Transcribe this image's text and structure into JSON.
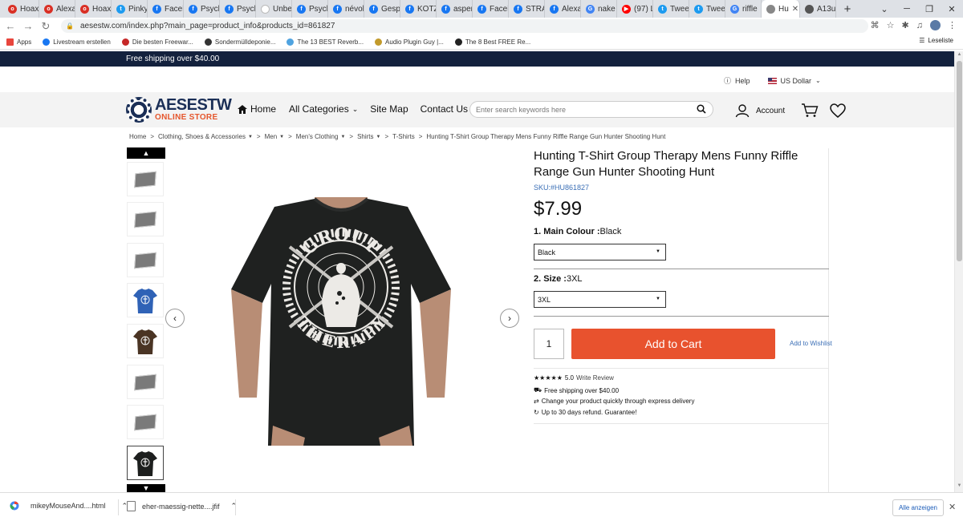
{
  "browser": {
    "tabs": [
      {
        "label": "Hoax",
        "color": "#d93025",
        "glyph": "o"
      },
      {
        "label": "Alexa",
        "color": "#d93025",
        "glyph": "o"
      },
      {
        "label": "Hoax",
        "color": "#d93025",
        "glyph": "o"
      },
      {
        "label": "Pinky",
        "color": "#1d9bf0",
        "glyph": "t"
      },
      {
        "label": "Faceb",
        "color": "#1877f2",
        "glyph": "f"
      },
      {
        "label": "Psych",
        "color": "#1877f2",
        "glyph": "f"
      },
      {
        "label": "Psych",
        "color": "#1877f2",
        "glyph": "f"
      },
      {
        "label": "Unbe",
        "color": "#ffffff",
        "glyph": ""
      },
      {
        "label": "Psych",
        "color": "#1877f2",
        "glyph": "f"
      },
      {
        "label": "névol",
        "color": "#1877f2",
        "glyph": "f"
      },
      {
        "label": "Gespi",
        "color": "#1877f2",
        "glyph": "f"
      },
      {
        "label": "KOTZ",
        "color": "#1877f2",
        "glyph": "f"
      },
      {
        "label": "asper",
        "color": "#1877f2",
        "glyph": "f"
      },
      {
        "label": "Faceb",
        "color": "#1877f2",
        "glyph": "f"
      },
      {
        "label": "STRA",
        "color": "#1877f2",
        "glyph": "f"
      },
      {
        "label": "Alexa",
        "color": "#1877f2",
        "glyph": "f"
      },
      {
        "label": "nake",
        "color": "#4285f4",
        "glyph": "G"
      },
      {
        "label": "(97) L",
        "color": "#ff0000",
        "glyph": "▶"
      },
      {
        "label": "Twee",
        "color": "#1d9bf0",
        "glyph": "t"
      },
      {
        "label": "Twee",
        "color": "#1d9bf0",
        "glyph": "t"
      },
      {
        "label": "riffle",
        "color": "#4285f4",
        "glyph": "G"
      },
      {
        "label": "Hu",
        "color": "#888888",
        "glyph": "",
        "active": true
      },
      {
        "label": "A13u",
        "color": "#555555",
        "glyph": ""
      }
    ],
    "url": "aesestw.com/index.php?main_page=product_info&products_id=861827",
    "bookmarks": [
      {
        "label": "Apps",
        "color": "#e8453c"
      },
      {
        "label": "Livestream erstellen",
        "color": "#1877f2"
      },
      {
        "label": "Die besten Freewar...",
        "color": "#c62828"
      },
      {
        "label": "Sondermülldeponie...",
        "color": "#333333"
      },
      {
        "label": "The 13 BEST Reverb...",
        "color": "#4fa3e0"
      },
      {
        "label": "Audio Plugin Guy |...",
        "color": "#c29a2b"
      },
      {
        "label": "The 8 Best FREE Re...",
        "color": "#222222"
      }
    ],
    "reading_list": "Leseliste"
  },
  "site": {
    "shipping_banner": "Free shipping over $40.00",
    "help": "Help",
    "currency": "US Dollar",
    "logo_main": "AESESTW",
    "logo_sub": "ONLINE STORE",
    "nav": {
      "home": "Home",
      "categories": "All Categories",
      "sitemap": "Site Map",
      "contact": "Contact Us"
    },
    "search_placeholder": "Enter search keywords here",
    "account": "Account"
  },
  "breadcrumb": {
    "home": "Home",
    "c1": "Clothing, Shoes & Accessories",
    "c2": "Men",
    "c3": "Men's Clothing",
    "c4": "Shirts",
    "c5": "T-Shirts",
    "current": "Hunting T-Shirt Group Therapy Mens Funny Riffle Range Gun Hunter Shooting Hunt"
  },
  "product": {
    "title": "Hunting T-Shirt Group Therapy Mens Funny Riffle Range Gun Hunter Shooting Hunt",
    "sku": "SKU:#HU861827",
    "price": "$7.99",
    "option1_label": "1. Main Colour :",
    "option1_value": "Black",
    "option1_select": "Black",
    "option2_label": "2. Size :",
    "option2_value": "3XL",
    "option2_select": "3XL",
    "quantity": "1",
    "add_to_cart": "Add to Cart",
    "wishlist": "Add to Wishlist",
    "rating": "5.0",
    "rating_stars": 5,
    "write_review": "Write Review",
    "perk_shipping": "Free shipping over $40.00",
    "perk_exchange": "Change your product quickly through express delivery",
    "perk_refund": "Up to 30 days refund. Guarantee!",
    "shirt_text_top": "GROUP",
    "shirt_text_bottom": "THERAPY"
  },
  "downloads": {
    "file1": "mikeyMouseAnd....html",
    "file2": "eher-maessig-nette....jfif",
    "show_all": "Alle anzeigen"
  }
}
